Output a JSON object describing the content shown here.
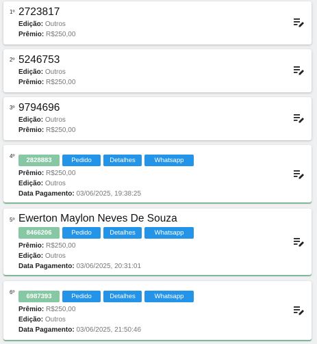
{
  "labels": {
    "edicao": "Edição:",
    "premio": "Prêmio:",
    "data_pagamento": "Data Pagamento:",
    "pedido": "Pedido",
    "detalhes": "Detalhes",
    "whatsapp": "Whatsapp"
  },
  "colors": {
    "ticket_badge": "#86c7a4",
    "action_button": "#2394e8",
    "paid_accent": "#8fc9a6"
  },
  "icons": {
    "edit": "edit-note-icon"
  },
  "winners": [
    {
      "position": "1º",
      "title": "2723817",
      "edicao": "Outros",
      "premio": "R$250,00"
    },
    {
      "position": "2º",
      "title": "5246753",
      "edicao": "Outros",
      "premio": "R$250,00"
    },
    {
      "position": "3º",
      "title": "9794696",
      "edicao": "Outros",
      "premio": "R$250,00"
    },
    {
      "position": "4º",
      "ticket": "2828883",
      "premio": "R$250,00",
      "edicao": "Outros",
      "data_pagamento": "03/06/2025, 19:38:25"
    },
    {
      "position": "5º",
      "title": "Ewerton Maylon Neves De Souza",
      "ticket": "8466206",
      "premio": "R$250,00",
      "edicao": "Outros",
      "data_pagamento": "03/06/2025, 20:31:01"
    },
    {
      "position": "6º",
      "ticket": "6987393",
      "premio": "R$250,00",
      "edicao": "Outros",
      "data_pagamento": "03/06/2025, 21:50:46"
    }
  ]
}
